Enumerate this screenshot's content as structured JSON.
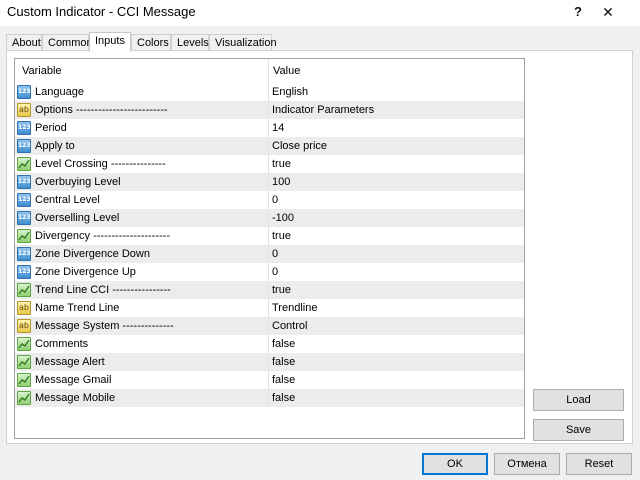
{
  "window": {
    "title": "Custom Indicator - CCI Message",
    "help_label": "?",
    "close_label": "✕"
  },
  "tabs": [
    {
      "label": "About"
    },
    {
      "label": "Common"
    },
    {
      "label": "Inputs"
    },
    {
      "label": "Colors"
    },
    {
      "label": "Levels"
    },
    {
      "label": "Visualization"
    }
  ],
  "active_tab": "Inputs",
  "grid": {
    "header_variable": "Variable",
    "header_value": "Value",
    "rows": [
      {
        "type": "num",
        "icon": "numeric-icon",
        "name": "Language",
        "value": "English"
      },
      {
        "type": "str",
        "icon": "string-icon",
        "name": "Options -------------------------",
        "value": "Indicator Parameters"
      },
      {
        "type": "num",
        "icon": "numeric-icon",
        "name": "Period",
        "value": "14"
      },
      {
        "type": "num",
        "icon": "numeric-icon",
        "name": "Apply to",
        "value": "Close price"
      },
      {
        "type": "bool",
        "icon": "boolean-icon",
        "name": "Level Crossing ---------------",
        "value": "true"
      },
      {
        "type": "num",
        "icon": "numeric-icon",
        "name": "Overbuying Level",
        "value": "100"
      },
      {
        "type": "num",
        "icon": "numeric-icon",
        "name": "Central Level",
        "value": "0"
      },
      {
        "type": "num",
        "icon": "numeric-icon",
        "name": "Overselling Level",
        "value": "-100"
      },
      {
        "type": "bool",
        "icon": "boolean-icon",
        "name": "Divergency ---------------------",
        "value": "true"
      },
      {
        "type": "num",
        "icon": "numeric-icon",
        "name": "Zone Divergence Down",
        "value": "0"
      },
      {
        "type": "num",
        "icon": "numeric-icon",
        "name": "Zone Divergence Up",
        "value": "0"
      },
      {
        "type": "bool",
        "icon": "boolean-icon",
        "name": "Trend Line CCI ----------------",
        "value": "true"
      },
      {
        "type": "str",
        "icon": "string-icon",
        "name": "Name Trend Line",
        "value": "Trendline"
      },
      {
        "type": "str",
        "icon": "string-icon",
        "name": "Message System --------------",
        "value": "Control"
      },
      {
        "type": "bool",
        "icon": "boolean-icon",
        "name": "Comments",
        "value": "false"
      },
      {
        "type": "bool",
        "icon": "boolean-icon",
        "name": "Message Alert",
        "value": "false"
      },
      {
        "type": "bool",
        "icon": "boolean-icon",
        "name": "Message Gmail",
        "value": "false"
      },
      {
        "type": "bool",
        "icon": "boolean-icon",
        "name": "Message Mobile",
        "value": "false"
      }
    ]
  },
  "buttons": {
    "load": "Load",
    "save": "Save",
    "ok": "OK",
    "cancel": "Отмена",
    "reset": "Reset"
  },
  "icon_labels": {
    "numeric": "123",
    "string": "ab"
  }
}
